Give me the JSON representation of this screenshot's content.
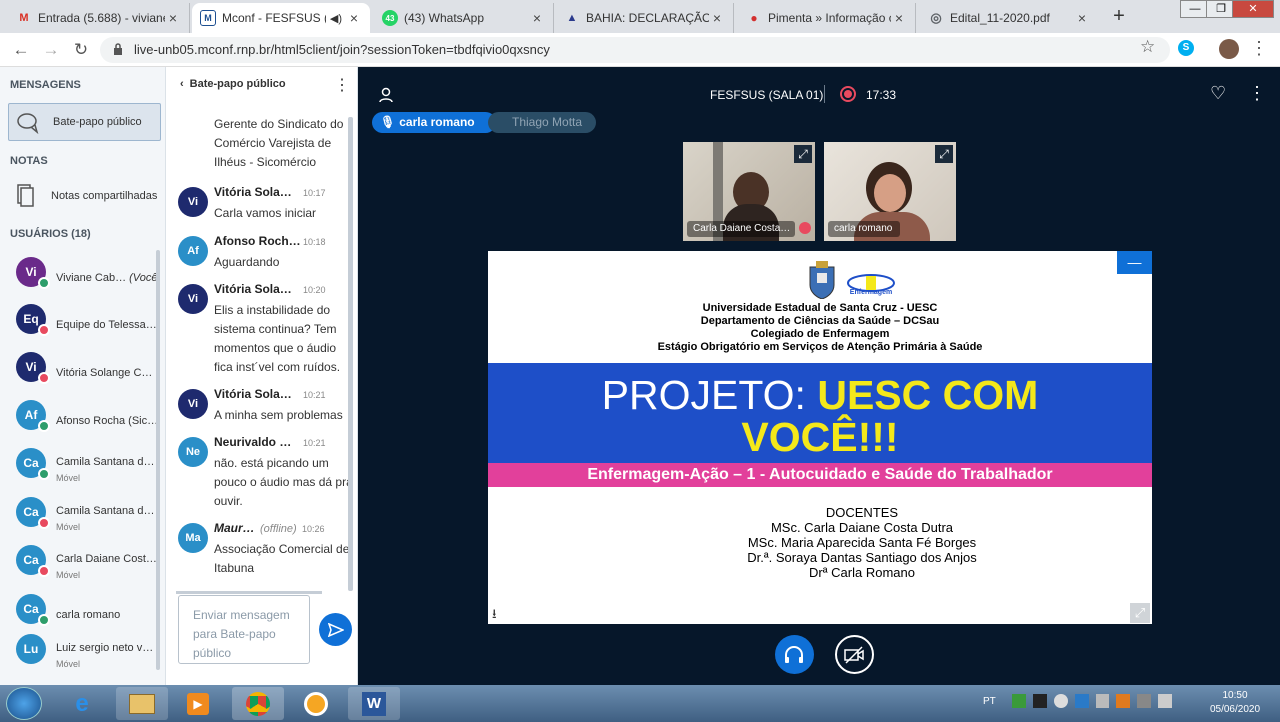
{
  "browser": {
    "tabs": [
      {
        "title": "Entrada (5.688) - viviane",
        "icon": "gmail-icon",
        "icon_text": "M",
        "icon_color": "#d93025"
      },
      {
        "title": "Mconf - FESFSUS (S",
        "icon": "mconf-icon",
        "icon_text": "M",
        "icon_color": "#1d4f91"
      },
      {
        "title": "(43) WhatsApp",
        "icon": "whatsapp-icon",
        "icon_text": "43",
        "icon_color": "#25d366"
      },
      {
        "title": "BAHIA: DECLARAÇÃO D",
        "icon": "bahia-icon",
        "icon_text": "▲",
        "icon_color": "#2b3a8c"
      },
      {
        "title": "Pimenta » Informação c",
        "icon": "pepper-icon",
        "icon_text": "🌶",
        "icon_color": "#d32f2f"
      },
      {
        "title": "Edital_11-2020.pdf",
        "icon": "globe-icon",
        "icon_text": "◎",
        "icon_color": "#5f6368"
      }
    ],
    "url": "live-unb05.mconf.rnp.br/html5client/join?sessionToken=tbdfqivio0qxsncy"
  },
  "sidebar": {
    "messages_header": "MENSAGENS",
    "public_chat": "Bate-papo público",
    "notes_header": "NOTAS",
    "shared_notes": "Notas compartilhadas",
    "users_header": "USUÁRIOS (18)",
    "users": [
      {
        "initials": "Vi",
        "name": "Viviane Cab…",
        "you": "(Você)",
        "sub": "",
        "color": "#6a2a8a",
        "status": "#2e9e6b"
      },
      {
        "initials": "Eq",
        "name": "Equipe do Telessa…",
        "you": "",
        "sub": "",
        "color": "#1e2a6e",
        "status": "#e84a5f"
      },
      {
        "initials": "Vi",
        "name": "Vitória Solange C…",
        "you": "",
        "sub": "",
        "color": "#1e2a6e",
        "status": "#e84a5f"
      },
      {
        "initials": "Af",
        "name": "Afonso Rocha (Sic…",
        "you": "",
        "sub": "",
        "color": "#2a8fc8",
        "status": "#2e9e6b"
      },
      {
        "initials": "Ca",
        "name": "Camila Santana d…",
        "you": "",
        "sub": "Móvel",
        "color": "#2a8fc8",
        "status": "#2e9e6b"
      },
      {
        "initials": "Ca",
        "name": "Camila Santana d…",
        "you": "",
        "sub": "Móvel",
        "color": "#2a8fc8",
        "status": "#e84a5f"
      },
      {
        "initials": "Ca",
        "name": "Carla Daiane Cost…",
        "you": "",
        "sub": "Móvel",
        "color": "#2a8fc8",
        "status": "#e84a5f"
      },
      {
        "initials": "Ca",
        "name": "carla romano",
        "you": "",
        "sub": "",
        "color": "#2a8fc8",
        "status": "#2e9e6b"
      },
      {
        "initials": "Lu",
        "name": "Luiz sergio neto v…",
        "you": "",
        "sub": "Móvel",
        "color": "#2a8fc8",
        "status": ""
      }
    ]
  },
  "chat": {
    "title": "Bate-papo público",
    "top_text": "Gerente do Sindicato do Comércio Varejista de Ilhéus - Sicomércio",
    "messages": [
      {
        "initials": "Vi",
        "name": "Vitória Sola…",
        "time": "10:17",
        "offline": "",
        "text": "Carla vamos iniciar",
        "color": "#1e2a6e"
      },
      {
        "initials": "Af",
        "name": "Afonso Roch…",
        "time": "10:18",
        "offline": "",
        "text": "Aguardando",
        "color": "#2a8fc8"
      },
      {
        "initials": "Vi",
        "name": "Vitória Sola…",
        "time": "10:20",
        "offline": "",
        "text": "Elis a instabilidade do sistema continua? Tem momentos que o áudio fica inst´vel com ruídos.",
        "color": "#1e2a6e"
      },
      {
        "initials": "Vi",
        "name": "Vitória Sola…",
        "time": "10:21",
        "offline": "",
        "text": "A minha sem problemas",
        "color": "#1e2a6e"
      },
      {
        "initials": "Ne",
        "name": "Neurivaldo …",
        "time": "10:21",
        "offline": "",
        "text": "não. está picando um pouco o áudio mas dá pra ouvir.",
        "color": "#2a8fc8"
      },
      {
        "initials": "Ma",
        "name": "Maur…",
        "time": "10:26",
        "offline": "(offline)",
        "text": "Associação Comercial de Itabuna",
        "color": "#2a8fc8"
      }
    ],
    "input_placeholder": "Enviar mensagem para Bate-papo público"
  },
  "meeting": {
    "title": "FESFSUS (SALA 01)",
    "timer": "17:33",
    "talkers": [
      "carla romano",
      "Thiago Motta"
    ],
    "cameras": [
      "Carla Daiane Costa…",
      "carla romano"
    ]
  },
  "slide": {
    "lines": [
      "Universidade Estadual de Santa Cruz - UESC",
      "Departamento de Ciências da Saúde – DCSau",
      "Colegiado de Enfermagem",
      "Estágio Obrigatório em Serviços de Atenção Primária à Saúde"
    ],
    "logo_text": "Enfermagem",
    "project_prefix": "PROJETO: ",
    "project_highlight_1": "UESC COM",
    "project_highlight_2": "VOCÊ!!!",
    "subtitle": "Enfermagem-Ação – 1 - Autocuidado e Saúde do Trabalhador",
    "docentes_title": "DOCENTES",
    "docentes": [
      "MSc. Carla Daiane Costa Dutra",
      "MSc. Maria Aparecida Santa Fé Borges",
      "Dr.ª. Soraya Dantas Santiago dos Anjos",
      "Drª Carla Romano"
    ],
    "colors": {
      "blue_band": "#1e4fc8",
      "yellow": "#f4e81a",
      "pink_band": "#e2409b"
    }
  },
  "taskbar": {
    "lang": "PT",
    "time": "10:50",
    "date": "05/06/2020"
  }
}
